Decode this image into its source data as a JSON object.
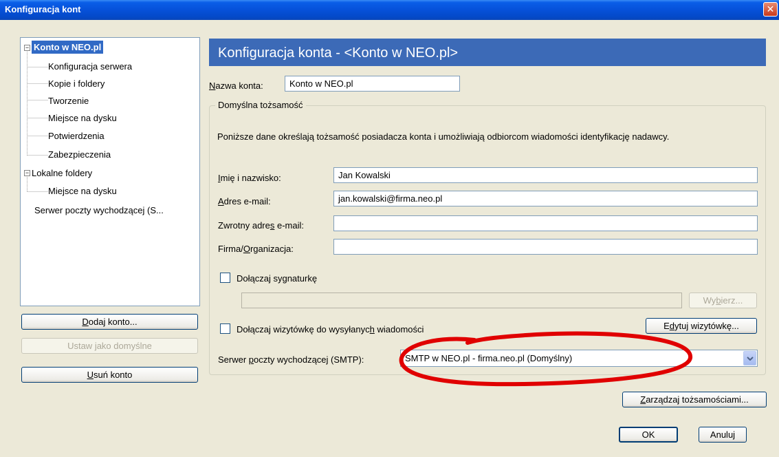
{
  "window": {
    "title": "Konfiguracja kont",
    "close_glyph": "✕"
  },
  "tree": {
    "items": [
      {
        "label": "Konto w NEO.pl"
      },
      {
        "label": "Konfiguracja serwera"
      },
      {
        "label": "Kopie i foldery"
      },
      {
        "label": "Tworzenie"
      },
      {
        "label": "Miejsce na dysku"
      },
      {
        "label": "Potwierdzenia"
      },
      {
        "label": "Zabezpieczenia"
      },
      {
        "label": "Lokalne foldery"
      },
      {
        "label": "Miejsce na dysku"
      },
      {
        "label": "Serwer poczty wychodzącej (S..."
      }
    ],
    "expander_glyph": "−"
  },
  "left_buttons": {
    "add_account": {
      "pre": "",
      "ul": "D",
      "post": "odaj konto..."
    },
    "set_default": {
      "pre": "Ustaw ",
      "ul": "j",
      "post": "ako domyślne"
    },
    "remove_account": {
      "pre": "",
      "ul": "U",
      "post": "suń konto"
    }
  },
  "main": {
    "header_title": "Konfiguracja konta - <Konto w NEO.pl>",
    "account_name": {
      "pre": "",
      "ul": "N",
      "post": "azwa konta:",
      "value": "Konto w NEO.pl"
    },
    "identity": {
      "legend": "Domyślna tożsamość",
      "description": "Poniższe dane określają tożsamość posiadacza konta i umożliwiają odbiorcom wiadomości identyfikację nadawcy.",
      "name": {
        "pre": "",
        "ul": "I",
        "post": "mię i nazwisko:",
        "value": "Jan Kowalski"
      },
      "email": {
        "pre": "",
        "ul": "A",
        "post": "dres e-mail:",
        "value": "jan.kowalski@firma.neo.pl"
      },
      "reply": {
        "pre": "Zwrotny adre",
        "ul": "s",
        "post": " e-mail:",
        "value": ""
      },
      "org": {
        "pre": "Firma/",
        "ul": "O",
        "post": "rganizacja:",
        "value": ""
      },
      "signature_check": {
        "pre": "Dołączaj sy",
        "ul": "g",
        "post": "naturkę"
      },
      "choose_button": {
        "pre": "Wy",
        "ul": "b",
        "post": "ierz..."
      },
      "vcard_check": {
        "pre": "Dołączaj wizytówkę do wysyłanyc",
        "ul": "h",
        "post": " wiadomości"
      },
      "edit_vcard_button": {
        "pre": "E",
        "ul": "d",
        "post": "ytuj wizytówkę..."
      },
      "smtp": {
        "pre": "Serwer ",
        "ul": "p",
        "post": "oczty wychodzącej (SMTP):",
        "value": "SMTP w NEO.pl - firma.neo.pl (Domyślny)"
      }
    },
    "manage_identities": {
      "pre": "",
      "ul": "Z",
      "post": "arządzaj tożsamościami..."
    }
  },
  "footer": {
    "ok": "OK",
    "cancel": "Anuluj"
  },
  "colors": {
    "annotation": "#e00000",
    "selection": "#316ac5",
    "header": "#3c6ab7"
  }
}
